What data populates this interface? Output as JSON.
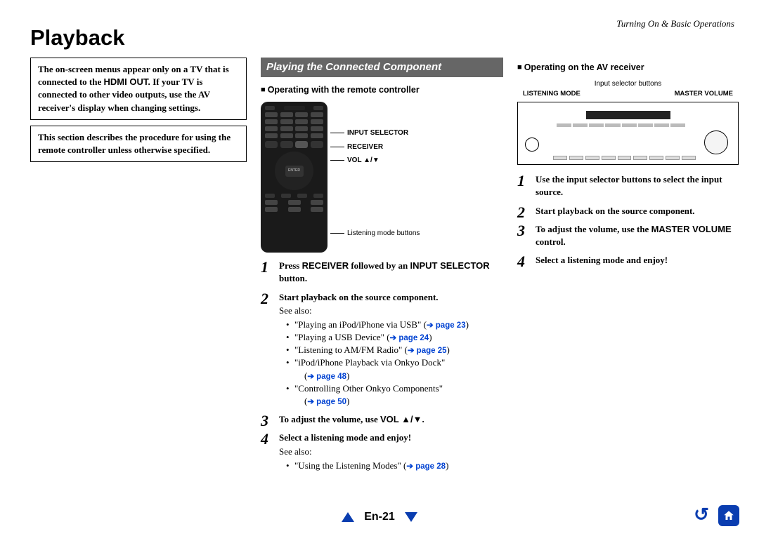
{
  "header": {
    "section": "Turning On & Basic Operations"
  },
  "title": "Playback",
  "col1": {
    "box1_a": "The on-screen menus appear only on a TV that is connected to the ",
    "box1_b": "HDMI OUT.",
    "box1_c": " If your TV is connected to other video outputs, use the AV receiver's display when changing settings.",
    "box2": "This section describes the procedure for using the remote controller unless otherwise specified."
  },
  "col2": {
    "bar": "Playing the Connected Component",
    "sub": "Operating with the remote controller",
    "callouts": {
      "c1": "INPUT SELECTOR",
      "c2": "RECEIVER",
      "c3": "VOL ▲/▼",
      "c4": "Listening mode buttons"
    },
    "steps": [
      {
        "head_a": "Press ",
        "head_b": "RECEIVER",
        "head_c": " followed by an ",
        "head_d": "INPUT SELECTOR",
        "head_e": " button."
      },
      {
        "head": "Start playback on the source component.",
        "sub": "See also:",
        "bullets": [
          {
            "t": "\"Playing an iPod/iPhone via USB\" (",
            "link": "➔ page 23",
            "end": ")"
          },
          {
            "t": "\"Playing a USB Device\" (",
            "link": "➔ page 24",
            "end": ")"
          },
          {
            "t": "\"Listening to AM/FM Radio\" (",
            "link": "➔ page 25",
            "end": ")"
          },
          {
            "t": "\"iPod/iPhone Playback via Onkyo Dock\"",
            "wrap": true,
            "link": "➔ page 48"
          },
          {
            "t": "\"Controlling Other Onkyo Components\"",
            "wrap": true,
            "link": "➔ page 50"
          }
        ]
      },
      {
        "head_a": "To adjust the volume, use ",
        "head_b": "VOL ▲/▼",
        "head_c": "."
      },
      {
        "head": "Select a listening mode and enjoy!",
        "sub": "See also:",
        "bullets": [
          {
            "t": "\"Using the Listening Modes\" (",
            "link": "➔ page 28",
            "end": ")"
          }
        ]
      }
    ]
  },
  "col3": {
    "sub": "Operating on the AV receiver",
    "diag": {
      "top": "Input selector buttons",
      "left": "LISTENING MODE",
      "right": "MASTER VOLUME"
    },
    "steps": [
      {
        "head": "Use the input selector buttons to select the input source."
      },
      {
        "head": "Start playback on the source component."
      },
      {
        "head_a": "To adjust the volume, use the ",
        "head_b": "MASTER VOLUME",
        "head_c": " control."
      },
      {
        "head": "Select a listening mode and enjoy!"
      }
    ]
  },
  "footer": {
    "page": "En-21"
  }
}
